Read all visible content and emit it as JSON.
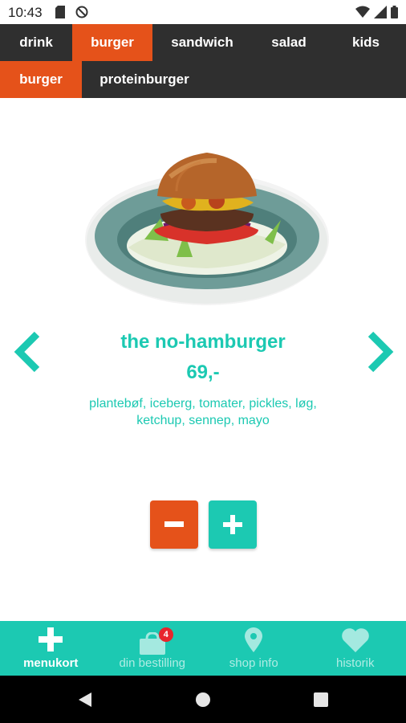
{
  "status_bar": {
    "time": "10:43"
  },
  "categories": [
    {
      "label": "drink",
      "active": false
    },
    {
      "label": "burger",
      "active": true
    },
    {
      "label": "sandwich",
      "active": false
    },
    {
      "label": "salad",
      "active": false
    },
    {
      "label": "kids",
      "active": false
    }
  ],
  "subcategories": [
    {
      "label": "burger",
      "active": true
    },
    {
      "label": "proteinburger",
      "active": false
    }
  ],
  "product": {
    "name": "the no-hamburger",
    "price": "69,-",
    "description_line1": "plantebøf, iceberg, tomater, pickles, løg,",
    "description_line2": "ketchup, sennep, mayo"
  },
  "bottom_nav": {
    "items": [
      {
        "label": "menukort",
        "icon": "plus-icon"
      },
      {
        "label": "din bestilling",
        "icon": "shopping-bag-icon",
        "badge": "4"
      },
      {
        "label": "shop info",
        "icon": "map-pin-icon"
      },
      {
        "label": "historik",
        "icon": "heart-icon"
      }
    ]
  },
  "colors": {
    "accent_orange": "#e5521a",
    "accent_teal": "#1cc9b2",
    "tab_bar": "#2f2f2f"
  }
}
